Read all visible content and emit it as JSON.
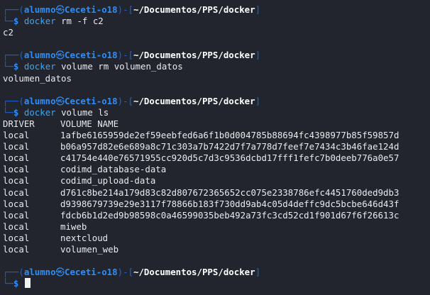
{
  "prompt": {
    "user": "alumno",
    "host": "Ceceti-o18",
    "path": "~/Documentos/PPS/docker",
    "symbol": "$",
    "skull_icon": "skull-icon"
  },
  "blocks": [
    {
      "command": "docker",
      "args": "rm -f c2",
      "output": [
        "c2"
      ]
    },
    {
      "command": "docker",
      "args": "volume rm volumen_datos",
      "output": [
        "volumen_datos"
      ]
    },
    {
      "command": "docker",
      "args": "volume ls",
      "table": {
        "headers": [
          "DRIVER",
          "VOLUME NAME"
        ],
        "rows": [
          [
            "local",
            "1afbe6165959de2ef59eebfed6a6f1b0d004785b88694fc4398977b85f59857d"
          ],
          [
            "local",
            "b06a957d82e6e689a8c71c303a7b7422d7f7a778d7feef7e7434c3b46fae124d"
          ],
          [
            "local",
            "c41754e440e76571955cc920d5c7d3c9536dcbd17fff1fefc7b0deeb776a0e57"
          ],
          [
            "local",
            "codimd_database-data"
          ],
          [
            "local",
            "codimd_upload-data"
          ],
          [
            "local",
            "d761c8be214a179d83c82d807672365652cc075e2338786efc4451760ded9db3"
          ],
          [
            "local",
            "d9398679739e29e3117f78866b183f730dd9ab4c05d4deffc9dc5bcbe646d43f"
          ],
          [
            "local",
            "fdcb6b1d2ed9b98598c0a46599035beb492a73fc3cd52cd1f901d67f6f26613c"
          ],
          [
            "local",
            "miweb"
          ],
          [
            "local",
            "nextcloud"
          ],
          [
            "local",
            "volumen_web"
          ]
        ]
      }
    }
  ],
  "colors": {
    "background": "#22252e",
    "frame": "#1b64d8",
    "prompt_accent": "#2f8ef6",
    "command": "#3fa7f0",
    "text": "#e9eaed"
  }
}
